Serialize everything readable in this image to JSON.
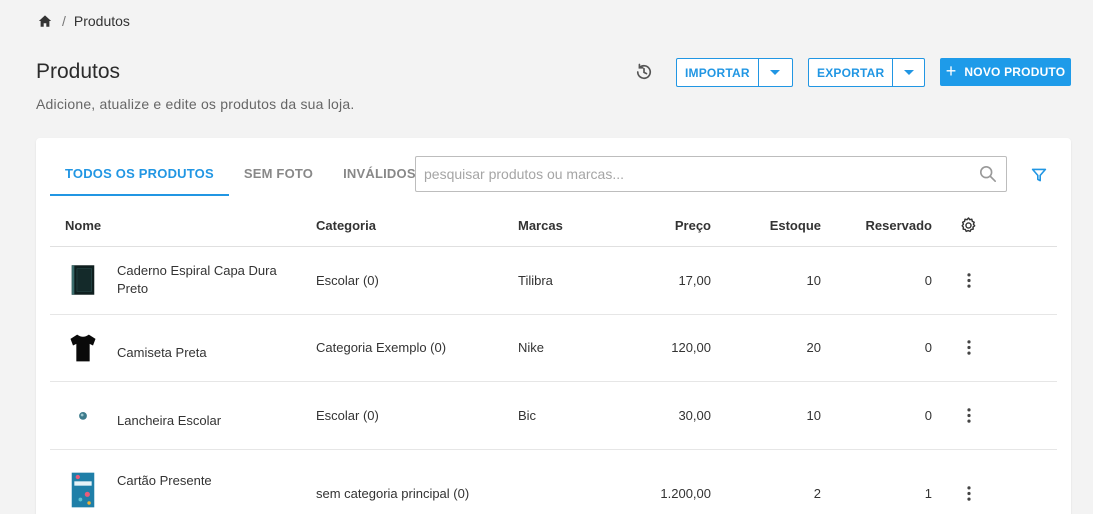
{
  "breadcrumb": {
    "home_icon": "home-icon",
    "separator": "/",
    "current": "Produtos"
  },
  "header": {
    "title": "Produtos",
    "subtitle": "Adicione, atualize e edite os produtos da sua loja.",
    "history_icon": "history-icon",
    "import_label": "IMPORTAR",
    "export_label": "EXPORTAR",
    "new_product_label": "NOVO PRODUTO"
  },
  "tabs": [
    {
      "label": "TODOS OS PRODUTOS",
      "active": true
    },
    {
      "label": "SEM FOTO",
      "active": false
    },
    {
      "label": "INVÁLIDOS",
      "active": false
    }
  ],
  "search": {
    "placeholder": "pesquisar produtos ou marcas...",
    "value": ""
  },
  "table": {
    "columns": {
      "name": "Nome",
      "category": "Categoria",
      "brand": "Marcas",
      "price": "Preço",
      "stock": "Estoque",
      "reserved": "Reservado"
    },
    "rows": [
      {
        "thumb": "notebook",
        "name": "Caderno Espiral Capa Dura Preto",
        "category": "Escolar (0)",
        "brand": "Tilibra",
        "price": "17,00",
        "stock": "10",
        "reserved": "0"
      },
      {
        "thumb": "tshirt",
        "name": "Camiseta Preta",
        "category": "Categoria Exemplo (0)",
        "brand": "Nike",
        "price": "120,00",
        "stock": "20",
        "reserved": "0"
      },
      {
        "thumb": "lunchbox",
        "name": "Lancheira Escolar",
        "category": "Escolar (0)",
        "brand": "Bic",
        "price": "30,00",
        "stock": "10",
        "reserved": "0"
      },
      {
        "thumb": "giftcard",
        "name": "Cartão Presente",
        "category": "sem categoria principal (0)",
        "brand": "",
        "price": "1.200,00",
        "stock": "2",
        "reserved": "1"
      }
    ]
  },
  "colors": {
    "accent": "#2196e3",
    "primary_button": "#1e9be9",
    "background": "#f3f3f3"
  }
}
